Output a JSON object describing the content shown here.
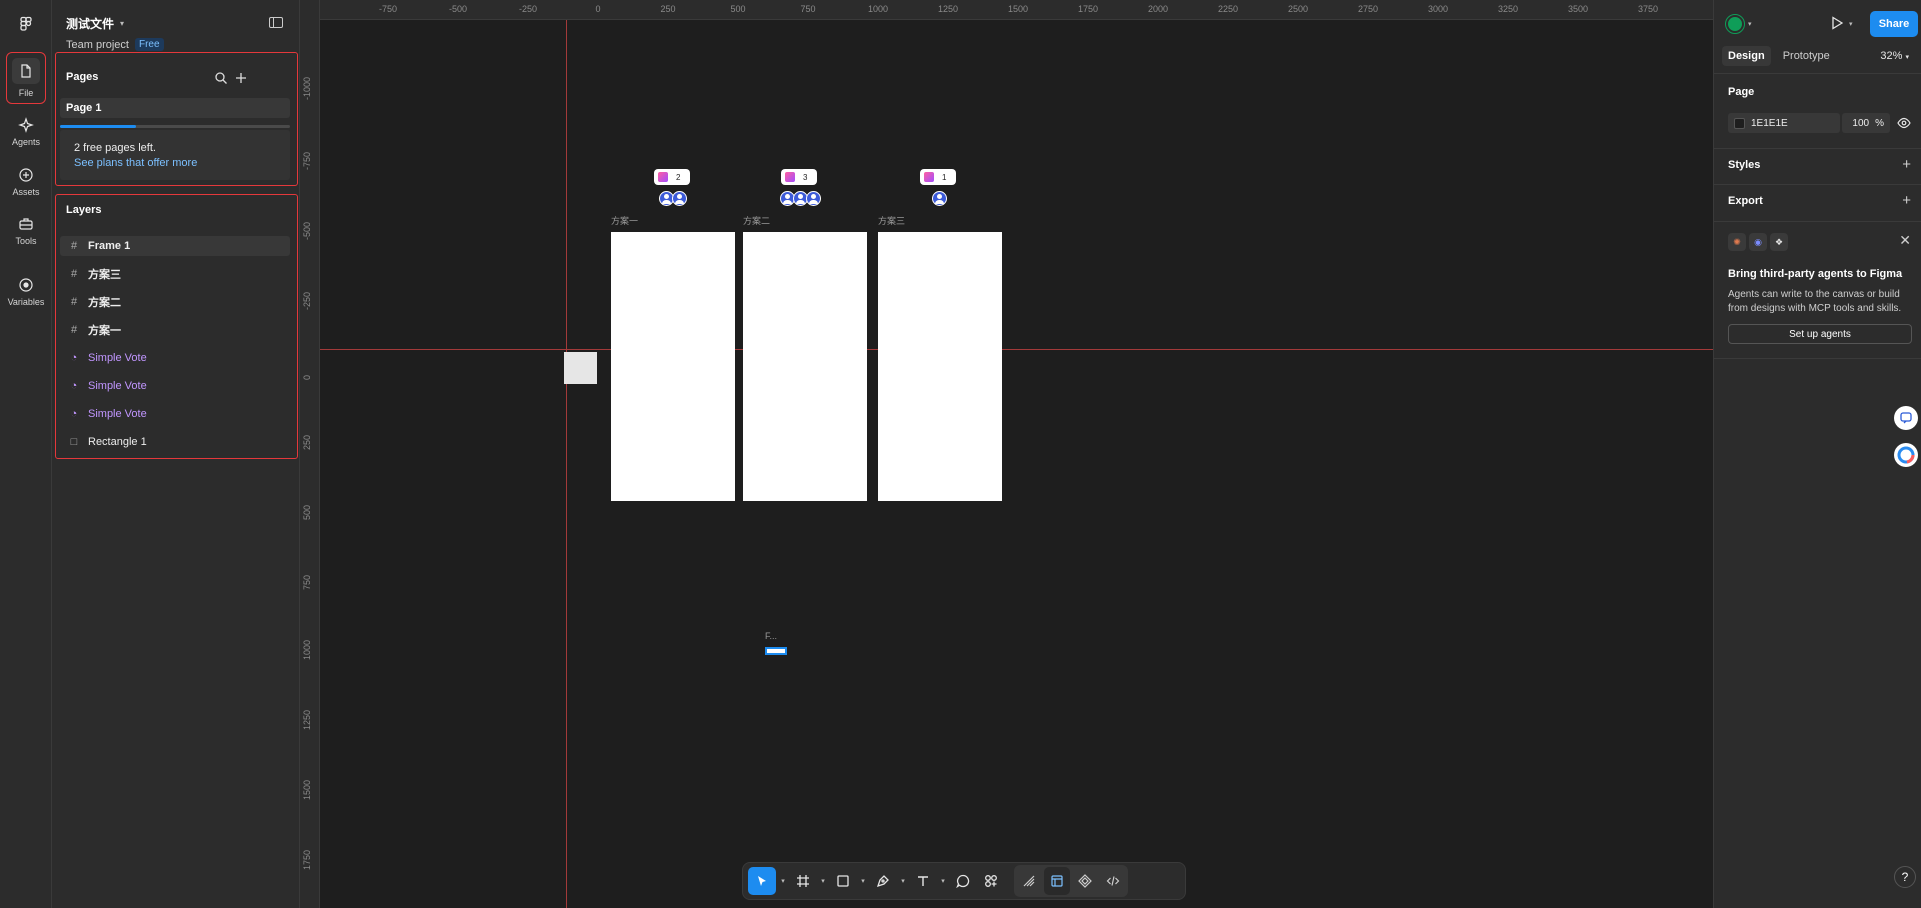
{
  "rail": {
    "items": [
      {
        "label": "File",
        "icon": "file-icon"
      },
      {
        "label": "Agents",
        "icon": "agents-icon"
      },
      {
        "label": "Assets",
        "icon": "assets-icon"
      },
      {
        "label": "Tools",
        "icon": "tools-icon"
      },
      {
        "label": "Variables",
        "icon": "variables-icon"
      }
    ]
  },
  "file": {
    "title": "测试文件",
    "team": "Team project",
    "plan_badge": "Free"
  },
  "pages": {
    "title": "Pages",
    "items": [
      "Page 1"
    ],
    "free_text": "2 free pages left.",
    "plans_link": "See plans that offer more",
    "usage_fraction": 0.33
  },
  "layers": {
    "title": "Layers",
    "items": [
      {
        "name": "Frame 1",
        "type": "frame"
      },
      {
        "name": "方案三",
        "type": "frame"
      },
      {
        "name": "方案二",
        "type": "frame"
      },
      {
        "name": "方案一",
        "type": "frame"
      },
      {
        "name": "Simple Vote",
        "type": "widget"
      },
      {
        "name": "Simple Vote",
        "type": "widget"
      },
      {
        "name": "Simple Vote",
        "type": "widget"
      },
      {
        "name": "Rectangle 1",
        "type": "rectangle"
      }
    ]
  },
  "canvas": {
    "ruler_top": [
      "-750",
      "-500",
      "-250",
      "0",
      "250",
      "500",
      "750",
      "1000",
      "1250",
      "1500",
      "1750",
      "2000",
      "2250",
      "2500",
      "2750",
      "3000",
      "3250",
      "3500",
      "3750"
    ],
    "ruler_left": [
      "-1000",
      "-750",
      "-500",
      "-250",
      "0",
      "250",
      "500",
      "750",
      "1000",
      "1250",
      "1500",
      "1750"
    ],
    "frames": [
      {
        "label": "方案一",
        "votes": "2",
        "voters": 2
      },
      {
        "label": "方案二",
        "votes": "3",
        "voters": 3
      },
      {
        "label": "方案三",
        "votes": "1",
        "voters": 1
      }
    ],
    "mini_frame_label": "F..."
  },
  "right": {
    "share": "Share",
    "tabs": [
      "Design",
      "Prototype"
    ],
    "zoom": "32%",
    "page_section": "Page",
    "bg_color": "1E1E1E",
    "bg_opacity": "100",
    "pct": "%",
    "styles": "Styles",
    "export": "Export",
    "agent_title": "Bring third-party agents to Figma",
    "agent_desc": "Agents can write to the canvas or build from designs with MCP tools and skills.",
    "agent_button": "Set up agents",
    "help": "?"
  },
  "colors": {
    "accent": "#1d8cf0",
    "highlight": "#e5383b",
    "canvas_bg": "#1e1e1e",
    "panel_bg": "#2c2c2c",
    "widget": "#c196ff"
  }
}
